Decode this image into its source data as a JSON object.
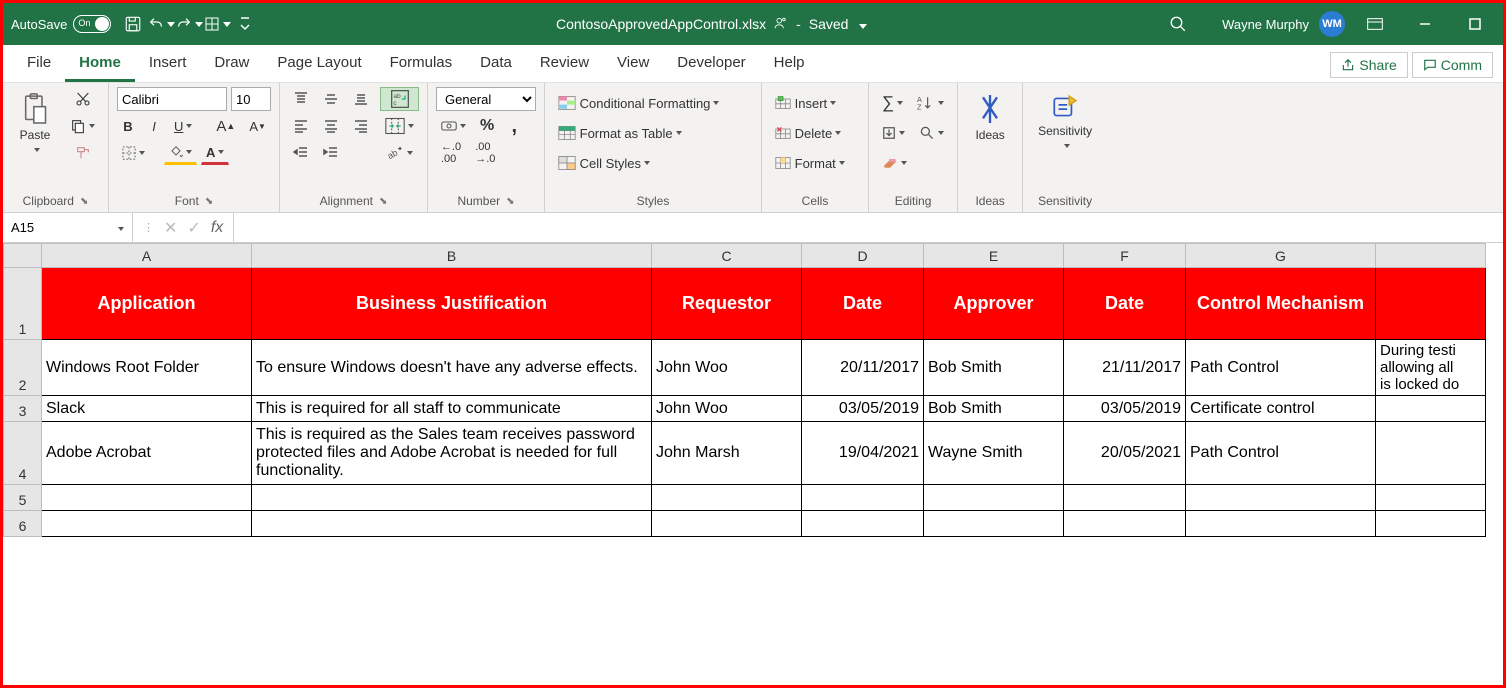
{
  "titlebar": {
    "autosave_label": "AutoSave",
    "toggle_state": "On",
    "doc_name": "ContosoApprovedAppControl.xlsx",
    "save_status": "Saved",
    "user_name": "Wayne Murphy",
    "user_initials": "WM"
  },
  "menu": {
    "tabs": [
      "File",
      "Home",
      "Insert",
      "Draw",
      "Page Layout",
      "Formulas",
      "Data",
      "Review",
      "View",
      "Developer",
      "Help"
    ],
    "active": "Home",
    "share": "Share",
    "comments": "Comm"
  },
  "ribbon": {
    "clipboard": {
      "paste": "Paste",
      "label": "Clipboard"
    },
    "font": {
      "name": "Calibri",
      "size": "10",
      "label": "Font"
    },
    "alignment": {
      "label": "Alignment"
    },
    "number": {
      "format": "General",
      "label": "Number"
    },
    "styles": {
      "cond": "Conditional Formatting",
      "table": "Format as Table",
      "cell": "Cell Styles",
      "label": "Styles"
    },
    "cells": {
      "insert": "Insert",
      "delete": "Delete",
      "format": "Format",
      "label": "Cells"
    },
    "editing": {
      "label": "Editing"
    },
    "ideas": {
      "label": "Ideas"
    },
    "sensitivity": {
      "btn": "Sensitivity",
      "label": "Sensitivity"
    }
  },
  "formulabar": {
    "cellref": "A15",
    "fx": "fx",
    "value": ""
  },
  "columns": [
    "A",
    "B",
    "C",
    "D",
    "E",
    "F",
    "G",
    ""
  ],
  "headers": [
    "Application",
    "Business Justification",
    "Requestor",
    "Date",
    "Approver",
    "Date",
    "Control Mechanism",
    ""
  ],
  "rows": [
    {
      "n": "2",
      "app": "Windows Root Folder",
      "just": "To ensure Windows doesn't have any adverse effects.",
      "req": "John Woo",
      "d1": "20/11/2017",
      "appr": "Bob Smith",
      "d2": "21/11/2017",
      "cm": "Path Control",
      "h": "During testi\nallowing all\nis locked do"
    },
    {
      "n": "3",
      "app": "Slack",
      "just": "This is required for all staff to communicate",
      "req": "John Woo",
      "d1": "03/05/2019",
      "appr": "Bob Smith",
      "d2": "03/05/2019",
      "cm": "Certificate control",
      "h": ""
    },
    {
      "n": "4",
      "app": "Adobe Acrobat",
      "just": "This is required as the Sales team receives password protected files and Adobe Acrobat is needed for full functionality.",
      "req": "John Marsh",
      "d1": "19/04/2021",
      "appr": "Wayne Smith",
      "d2": "20/05/2021",
      "cm": "Path Control",
      "h": ""
    },
    {
      "n": "5",
      "app": "",
      "just": "",
      "req": "",
      "d1": "",
      "appr": "",
      "d2": "",
      "cm": "",
      "h": ""
    },
    {
      "n": "6",
      "app": "",
      "just": "",
      "req": "",
      "d1": "",
      "appr": "",
      "d2": "",
      "cm": "",
      "h": ""
    }
  ]
}
